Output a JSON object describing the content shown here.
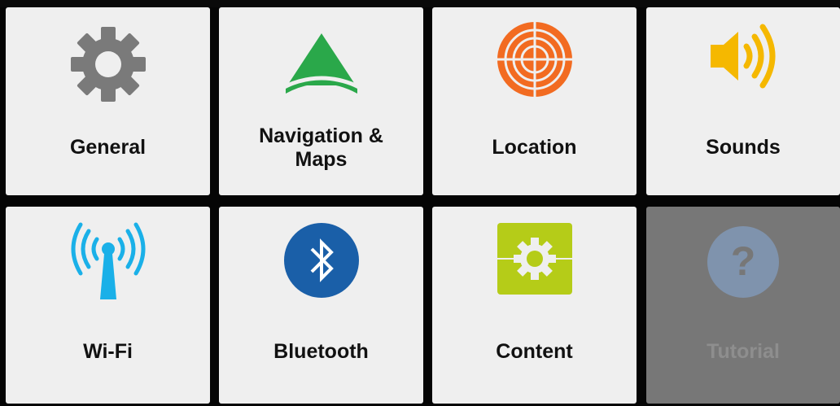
{
  "tiles": [
    {
      "id": "general",
      "label": "General",
      "icon": "gear-icon",
      "color": "#7a7a7a"
    },
    {
      "id": "navigation",
      "label": "Navigation &\nMaps",
      "icon": "navigation-arrow-icon",
      "color": "#2aa84a"
    },
    {
      "id": "location",
      "label": "Location",
      "icon": "location-target-icon",
      "color": "#f26b21"
    },
    {
      "id": "sounds",
      "label": "Sounds",
      "icon": "speaker-icon",
      "color": "#f5b800"
    },
    {
      "id": "wifi",
      "label": "Wi-Fi",
      "icon": "wifi-antenna-icon",
      "color": "#1ab0e8"
    },
    {
      "id": "bluetooth",
      "label": "Bluetooth",
      "icon": "bluetooth-icon",
      "color": "#1a5fa8"
    },
    {
      "id": "content",
      "label": "Content",
      "icon": "content-gear-icon",
      "color": "#b5cc18"
    },
    {
      "id": "tutorial",
      "label": "Tutorial",
      "icon": "help-question-icon",
      "color": "#7f93ad",
      "disabled": true
    }
  ]
}
